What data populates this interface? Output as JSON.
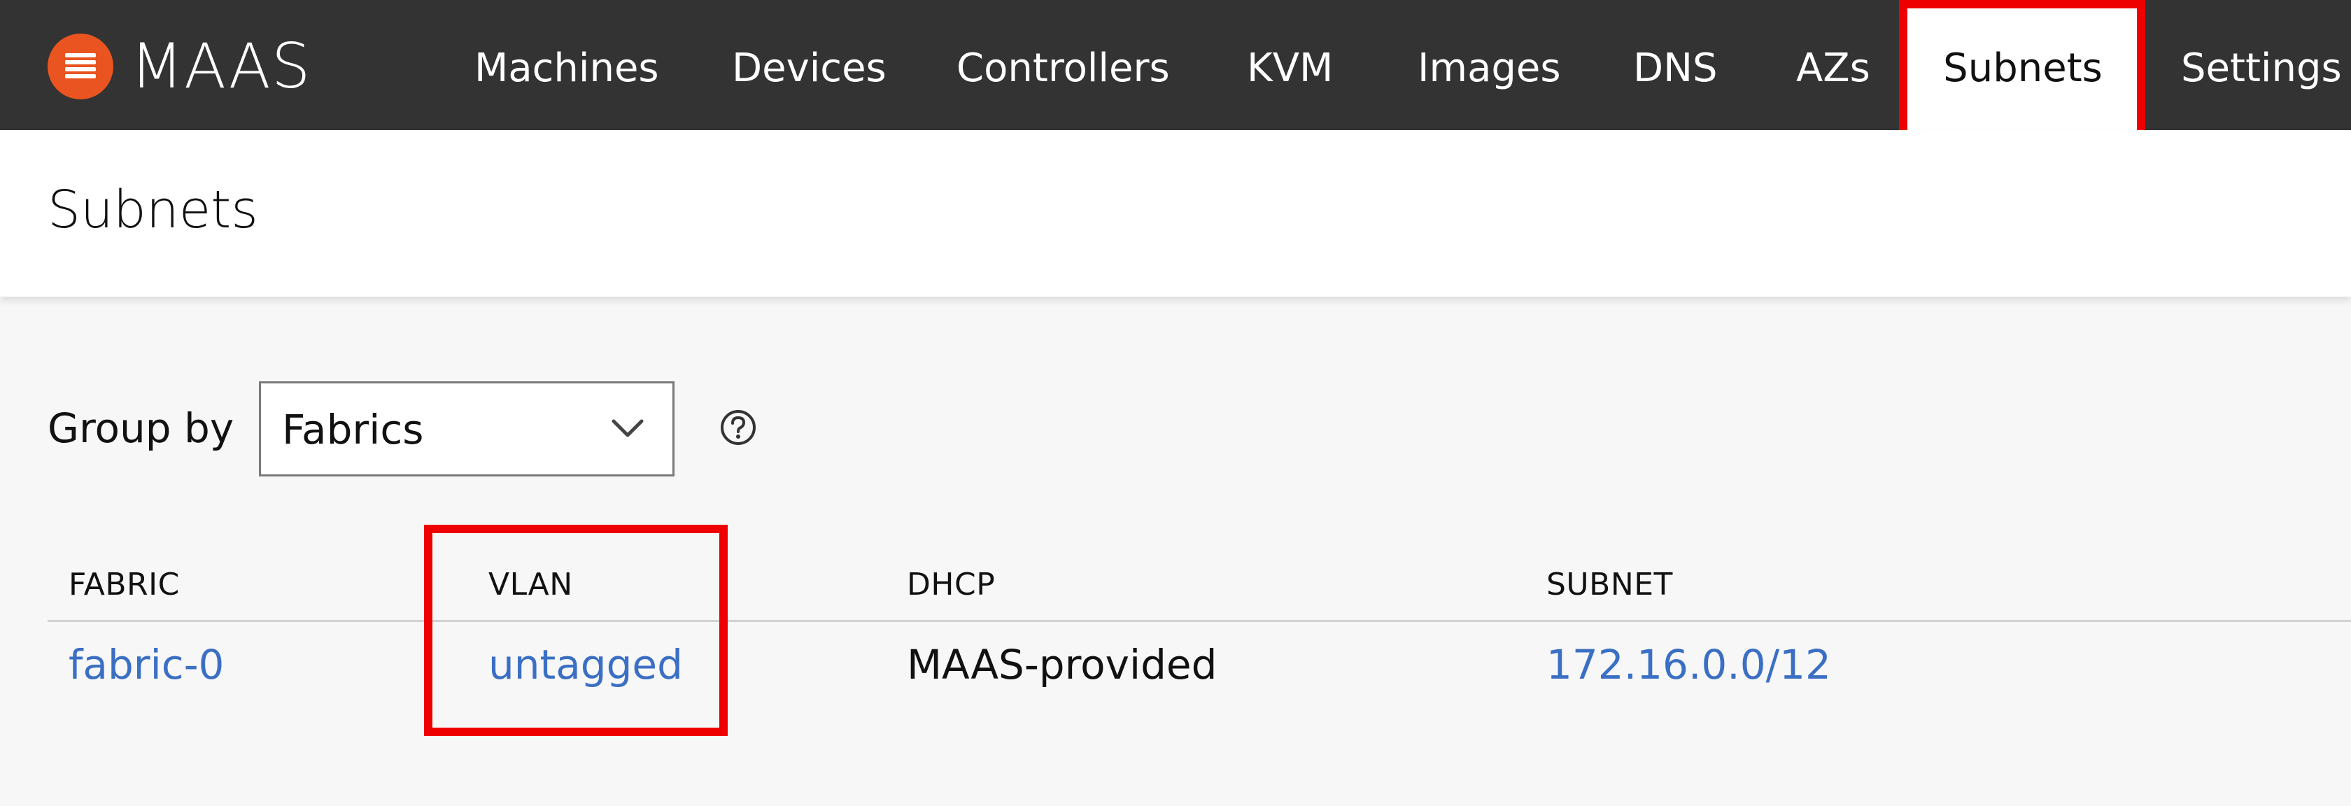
{
  "app": {
    "logo_text": "MAAS",
    "brand_color": "#e95420",
    "logo_icon": "maas-logo-icon"
  },
  "nav": {
    "items": [
      {
        "label": "Machines"
      },
      {
        "label": "Devices"
      },
      {
        "label": "Controllers"
      },
      {
        "label": "KVM"
      },
      {
        "label": "Images"
      },
      {
        "label": "DNS"
      },
      {
        "label": "AZs"
      },
      {
        "label": "Subnets",
        "active": true
      },
      {
        "label": "Settings"
      }
    ]
  },
  "header": {
    "title": "Subnets"
  },
  "group_by": {
    "label": "Group by",
    "selected": "Fabrics",
    "help_icon": "help-circle-icon"
  },
  "table": {
    "columns": [
      "FABRIC",
      "VLAN",
      "DHCP",
      "SUBNET"
    ],
    "rows": [
      {
        "fabric": "fabric-0",
        "vlan": "untagged",
        "dhcp": "MAAS-provided",
        "subnet": "172.16.0.0/12"
      }
    ]
  },
  "colors": {
    "navbar": "#333333",
    "link": "#3a6fc4",
    "highlight": "#ee0000",
    "background": "#f7f7f7"
  }
}
